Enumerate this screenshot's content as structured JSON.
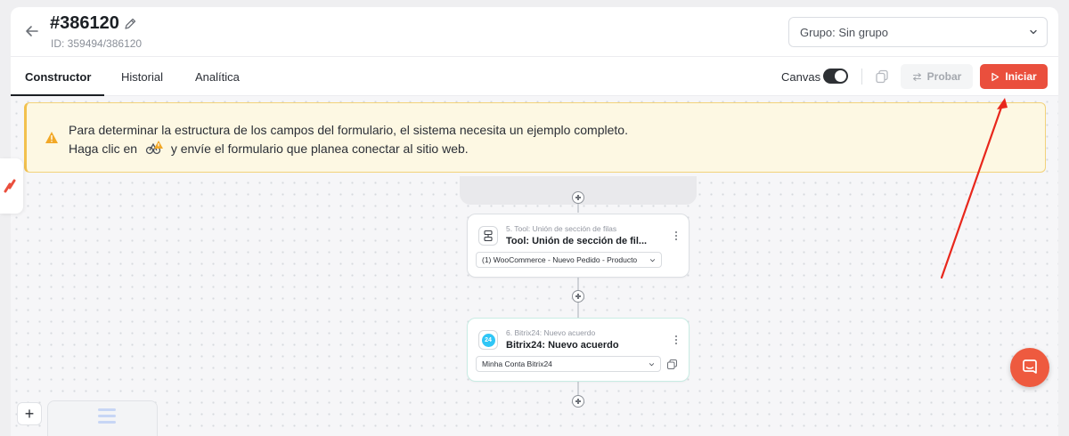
{
  "header": {
    "title": "#386120",
    "subtitle": "ID: 359494/386120",
    "group_select_value": "Grupo: Sin grupo"
  },
  "tabs": [
    {
      "label": "Constructor",
      "active": true
    },
    {
      "label": "Historial",
      "active": false
    },
    {
      "label": "Analítica",
      "active": false
    }
  ],
  "toolbar": {
    "canvas_label": "Canvas",
    "canvas_enabled": true,
    "test_label": "Probar",
    "start_label": "Iniciar"
  },
  "warning": {
    "line1": "Para determinar la estructura de los campos del formulario, el sistema necesita un ejemplo completo.",
    "line2_before": "Haga clic en",
    "line2_after": "y envíe el formulario que planea conectar al sitio web."
  },
  "nodes": [
    {
      "step": "5. Tool: Unión de sección de filas",
      "title": "Tool: Unión de sección de fil...",
      "dropdown": "(1) WooCommerce - Nuevo Pedido - Producto",
      "icon": "merge-rows-icon"
    },
    {
      "step": "6. Bitrix24: Nuevo acuerdo",
      "title": "Bitrix24: Nuevo acuerdo",
      "dropdown": "Minha Conta Bitrix24",
      "icon": "bitrix24-icon",
      "icon_text": "24"
    }
  ],
  "colors": {
    "accent": "#ea4f3d",
    "warning_bg": "#fdf8e3",
    "warning_border": "#f2c14e",
    "bitrix": "#2fc6f6",
    "annotation_arrow": "#e8271c"
  },
  "zoom": {
    "plus_label": "+"
  }
}
